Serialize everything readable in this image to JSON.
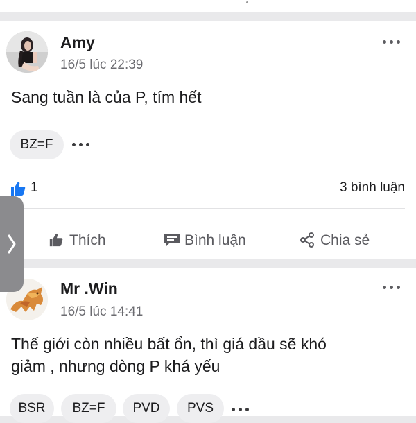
{
  "posts": [
    {
      "author": "Amy",
      "time": "16/5 lúc 22:39",
      "content": "Sang tuần là của P, tím hết",
      "tags": [
        "BZ=F"
      ],
      "like_count": "1",
      "comment_count": "3 bình luận",
      "actions": {
        "like": "Thích",
        "comment": "Bình luận",
        "share": "Chia sẻ"
      }
    },
    {
      "author": "Mr .Win",
      "time": "16/5 lúc 14:41",
      "content_line1": "Thế giới còn nhiều bất ổn, thì giá dầu sẽ khó",
      "content_line2": "giảm , nhưng dòng P khá yếu",
      "tags": [
        "BSR",
        "BZ=F",
        "PVD",
        "PVS"
      ]
    }
  ],
  "colors": {
    "like_blue": "#1877f2",
    "background": "#e9e9eb",
    "card": "#ffffff",
    "muted_text": "#6b6b70"
  },
  "icons": [
    "more-horizontal-icon",
    "thumbs-up-icon",
    "comment-icon",
    "share-icon",
    "chevron-right-icon"
  ]
}
